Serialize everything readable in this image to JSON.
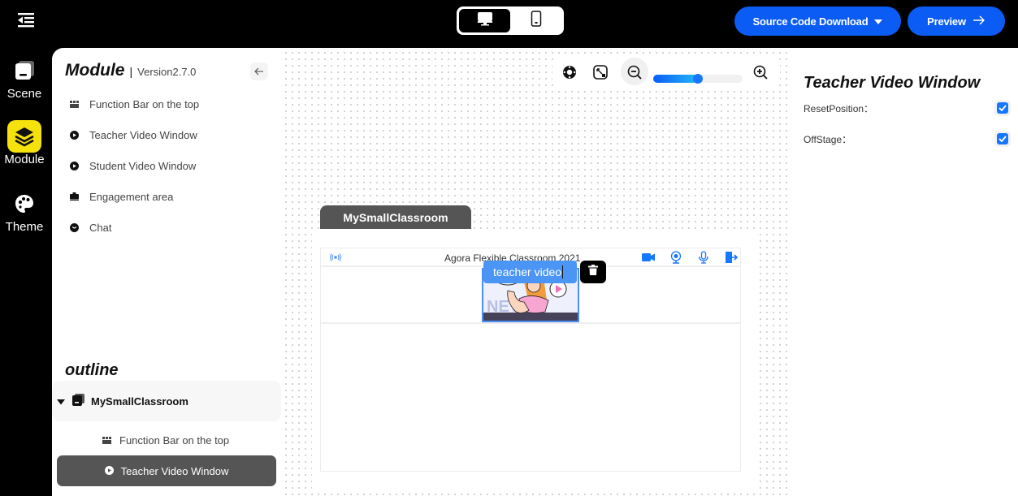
{
  "topbar": {
    "menu_icon": "collapse-menu-icon",
    "device_toggle": {
      "options": [
        "desktop",
        "mobile"
      ],
      "selected": "desktop"
    },
    "source_download_label": "Source Code Download",
    "preview_label": "Preview"
  },
  "rail": {
    "items": [
      {
        "label": "Scene",
        "icon": "scene-icon",
        "active": false
      },
      {
        "label": "Module",
        "icon": "layers-icon",
        "active": true
      },
      {
        "label": "Theme",
        "icon": "palette-icon",
        "active": false
      }
    ]
  },
  "left_panel": {
    "title": "Module",
    "separator": "|",
    "version": "Version2.7.0",
    "modules": [
      {
        "label": "Function Bar on the top",
        "icon": "function-bar-icon"
      },
      {
        "label": "Teacher Video Window",
        "icon": "play-circle-icon"
      },
      {
        "label": "Student Video Window",
        "icon": "play-circle-icon"
      },
      {
        "label": "Engagement area",
        "icon": "briefcase-icon"
      },
      {
        "label": "Chat",
        "icon": "chat-icon"
      }
    ],
    "outline_title": "outline",
    "outline": {
      "root": "MySmallClassroom",
      "children": [
        {
          "label": "Function Bar on the top",
          "selected": false
        },
        {
          "label": "Teacher Video Window",
          "selected": true
        }
      ]
    }
  },
  "canvas": {
    "zoom_level": 0.5,
    "classroom_tab": "MySmallClassroom",
    "header_title": "Agora Flexible Classroom 2021",
    "teacher_label_input": "teacher video",
    "accent": "#4b95f5"
  },
  "right_panel": {
    "title": "Teacher Video Window",
    "options": [
      {
        "label": "ResetPosition：",
        "checked": true
      },
      {
        "label": "OffStage：",
        "checked": true
      }
    ]
  }
}
